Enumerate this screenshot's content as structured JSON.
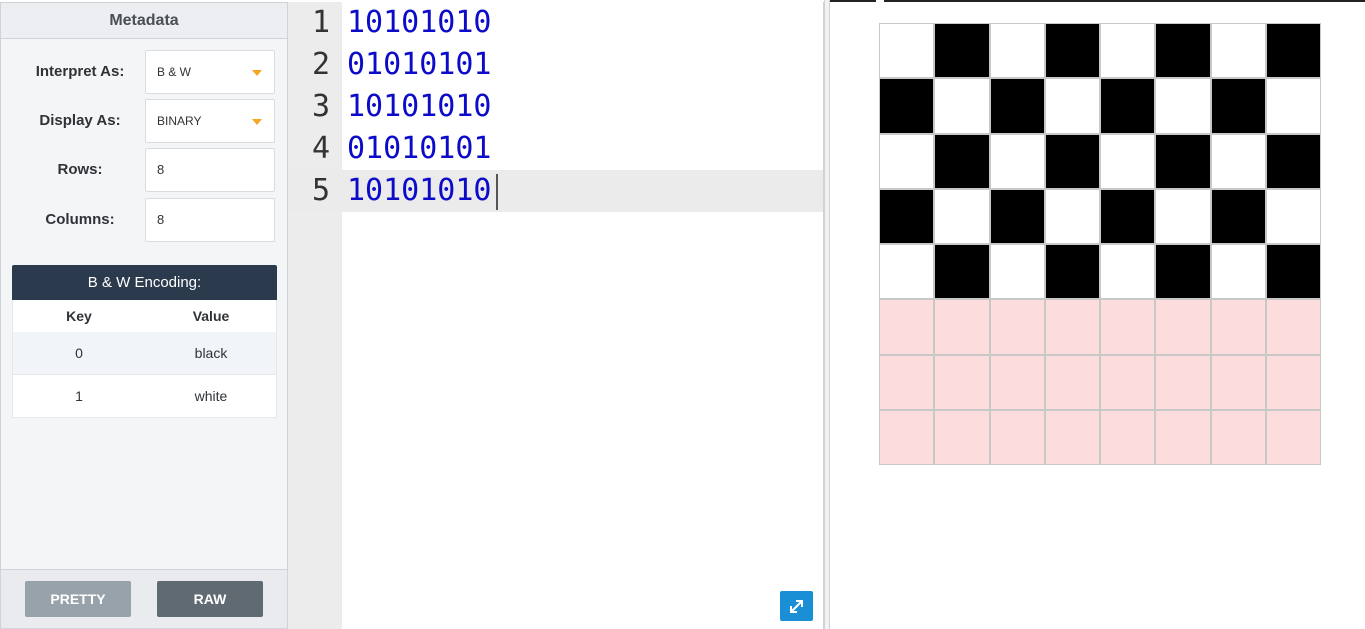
{
  "metadata": {
    "title": "Metadata",
    "interpret_as": {
      "label": "Interpret As:",
      "value": "B & W"
    },
    "display_as": {
      "label": "Display As:",
      "value": "BINARY"
    },
    "rows": {
      "label": "Rows:",
      "value": "8"
    },
    "columns": {
      "label": "Columns:",
      "value": "8"
    },
    "encoding": {
      "title": "B & W Encoding:",
      "key_header": "Key",
      "value_header": "Value",
      "rows": [
        {
          "key": "0",
          "value": "black"
        },
        {
          "key": "1",
          "value": "white"
        }
      ]
    },
    "pretty_button": "PRETTY",
    "raw_button": "RAW"
  },
  "editor": {
    "lines": [
      {
        "num": "1",
        "code": "10101010"
      },
      {
        "num": "2",
        "code": "01010101"
      },
      {
        "num": "3",
        "code": "10101010"
      },
      {
        "num": "4",
        "code": "01010101"
      },
      {
        "num": "5",
        "code": "10101010"
      }
    ],
    "active_line": 5
  },
  "image": {
    "rows": 8,
    "columns": 8,
    "colors": {
      "0": "#000000",
      "1": "#ffffff",
      "empty": "#fcdcdc"
    }
  },
  "colors": {
    "accent": "#f5a623",
    "header_dark": "#2b3a4d",
    "code": "#0b0bc9",
    "expand_button": "#1b8fd6"
  }
}
